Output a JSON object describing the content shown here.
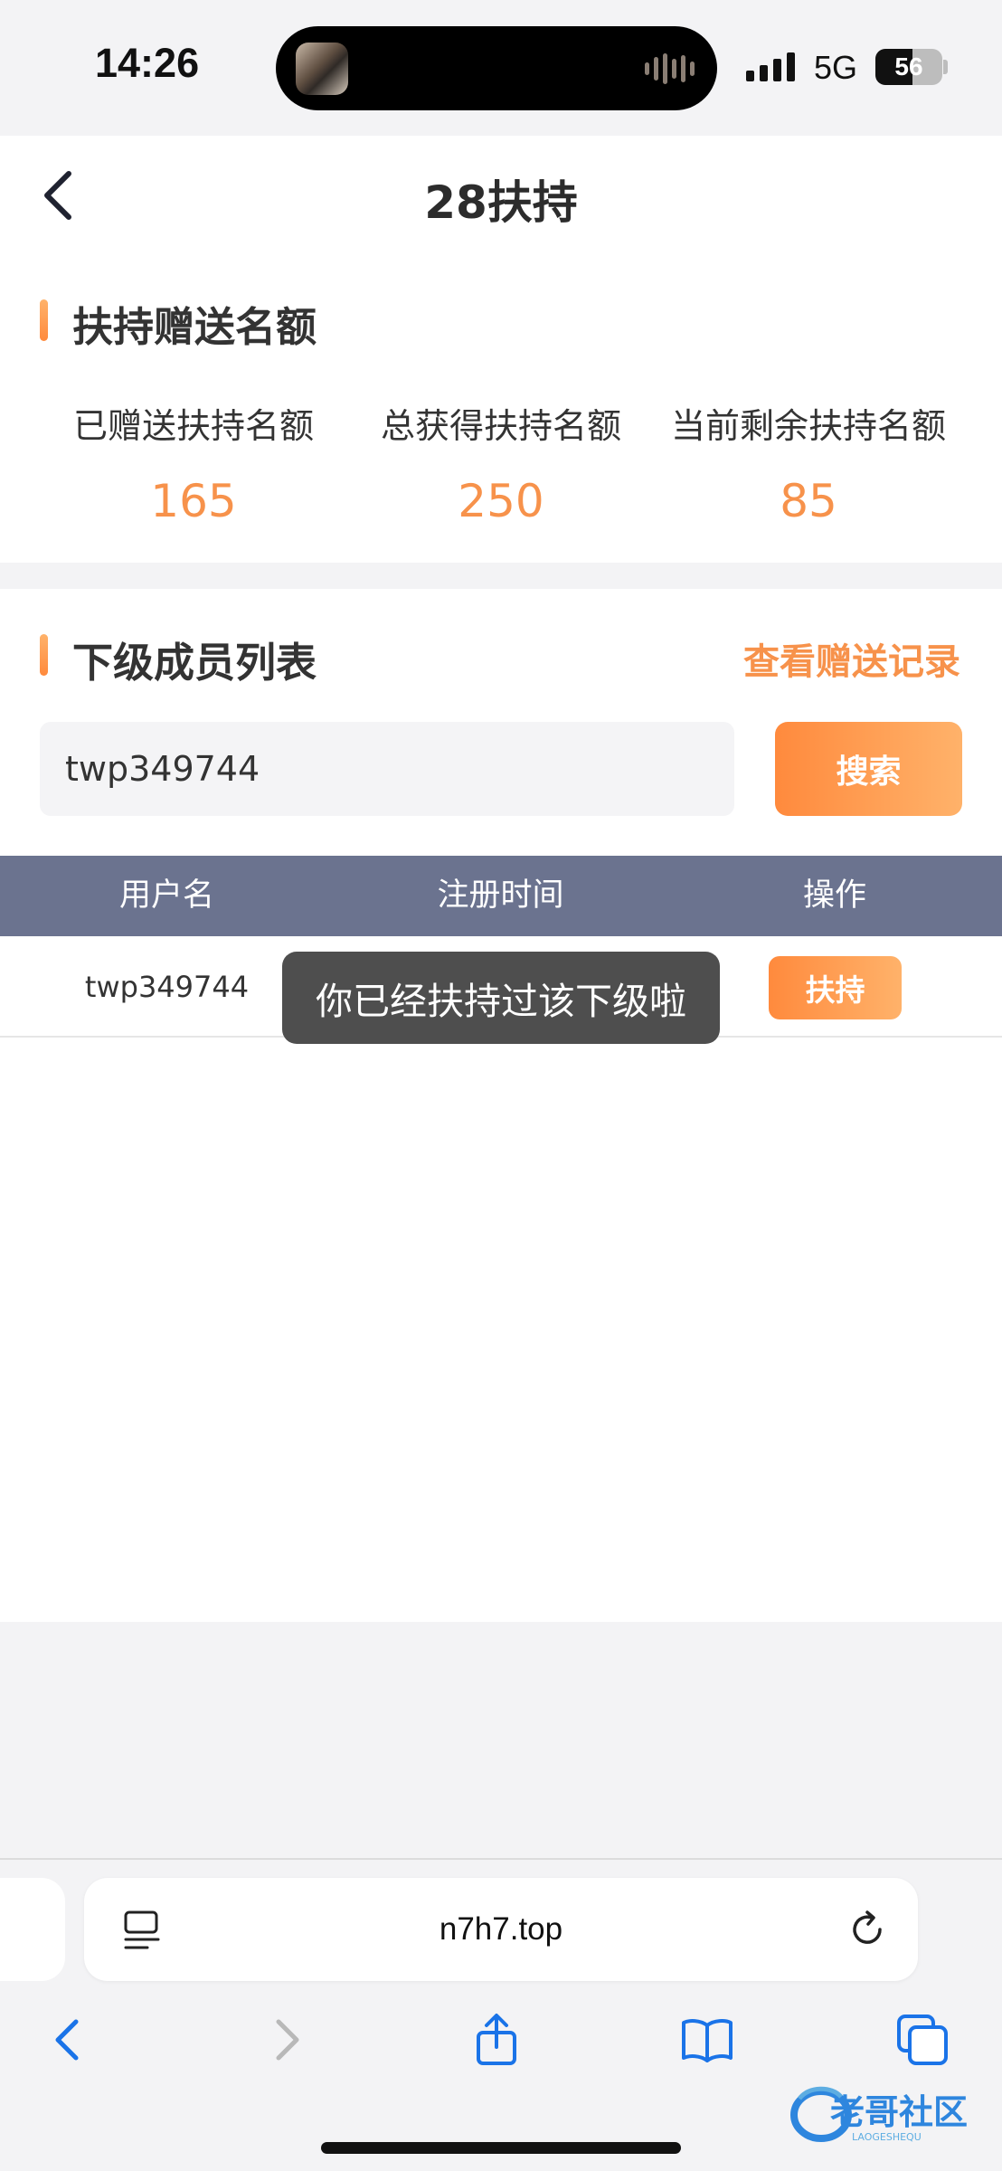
{
  "status_bar": {
    "time": "14:26",
    "network": "5G",
    "battery": "56"
  },
  "nav": {
    "title": "28扶持"
  },
  "quota": {
    "title": "扶持赠送名额",
    "stats": [
      {
        "label": "已赠送扶持名额",
        "value": "165"
      },
      {
        "label": "总获得扶持名额",
        "value": "250"
      },
      {
        "label": "当前剩余扶持名额",
        "value": "85"
      }
    ]
  },
  "members": {
    "title": "下级成员列表",
    "records_link": "查看赠送记录",
    "search": {
      "value": "twp349744",
      "button": "搜索"
    },
    "columns": [
      "用户名",
      "注册时间",
      "操作"
    ],
    "rows": [
      {
        "username": "twp349744",
        "register_time": "",
        "action": "扶持"
      }
    ]
  },
  "toast": "你已经扶持过该下级啦",
  "browser": {
    "url": "n7h7.top"
  },
  "watermark": {
    "text": "老哥社区",
    "sub": "LAOGESHEQU"
  },
  "colors": {
    "accent": "#f7924b",
    "table_header": "#6b738f"
  }
}
